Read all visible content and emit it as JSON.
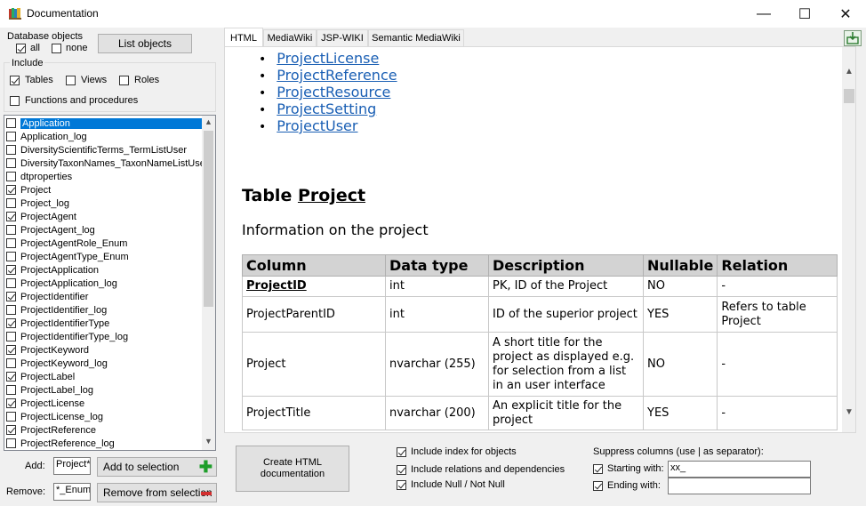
{
  "window": {
    "title": "Documentation",
    "minimize": "—",
    "maximize": "☐",
    "close": "✕"
  },
  "left": {
    "db_objects_label": "Database objects",
    "all_label": "all",
    "none_label": "none",
    "list_objects_button": "List objects",
    "include_label": "Include",
    "tables_label": "Tables",
    "views_label": "Views",
    "roles_label": "Roles",
    "functions_label": "Functions and procedures",
    "objects": [
      {
        "name": "Application",
        "checked": false,
        "selected": true
      },
      {
        "name": "Application_log",
        "checked": false
      },
      {
        "name": "DiversityScientificTerms_TermListUser",
        "checked": false
      },
      {
        "name": "DiversityTaxonNames_TaxonNameListUser",
        "checked": false
      },
      {
        "name": "dtproperties",
        "checked": false
      },
      {
        "name": "Project",
        "checked": true
      },
      {
        "name": "Project_log",
        "checked": false
      },
      {
        "name": "ProjectAgent",
        "checked": true
      },
      {
        "name": "ProjectAgent_log",
        "checked": false
      },
      {
        "name": "ProjectAgentRole_Enum",
        "checked": false
      },
      {
        "name": "ProjectAgentType_Enum",
        "checked": false
      },
      {
        "name": "ProjectApplication",
        "checked": true
      },
      {
        "name": "ProjectApplication_log",
        "checked": false
      },
      {
        "name": "ProjectIdentifier",
        "checked": true
      },
      {
        "name": "ProjectIdentifier_log",
        "checked": false
      },
      {
        "name": "ProjectIdentifierType",
        "checked": true
      },
      {
        "name": "ProjectIdentifierType_log",
        "checked": false
      },
      {
        "name": "ProjectKeyword",
        "checked": true
      },
      {
        "name": "ProjectKeyword_log",
        "checked": false
      },
      {
        "name": "ProjectLabel",
        "checked": true
      },
      {
        "name": "ProjectLabel_log",
        "checked": false
      },
      {
        "name": "ProjectLicense",
        "checked": true
      },
      {
        "name": "ProjectLicense_log",
        "checked": false
      },
      {
        "name": "ProjectReference",
        "checked": true
      },
      {
        "name": "ProjectReference_log",
        "checked": false
      }
    ],
    "add_label": "Add:",
    "add_value": "Project*",
    "add_button": "Add to selection",
    "remove_label": "Remove:",
    "remove_value": "*_Enum",
    "remove_button": "Remove from selection"
  },
  "tabs": [
    "HTML",
    "MediaWiki",
    "JSP-WIKI",
    "Semantic MediaWiki"
  ],
  "doc": {
    "links": [
      "ProjectLicense",
      "ProjectReference",
      "ProjectResource",
      "ProjectSetting",
      "ProjectUser"
    ],
    "table_heading_prefix": "Table ",
    "table_heading_name": "Project",
    "table_description": "Information on the project",
    "columns": [
      "Column",
      "Data type",
      "Description",
      "Nullable",
      "Relation"
    ],
    "rows": [
      {
        "column": "ProjectID",
        "pk": true,
        "type": "int",
        "description": "PK, ID of the Project",
        "nullable": "NO",
        "relation": "-"
      },
      {
        "column": "ProjectParentID",
        "type": "int",
        "description": "ID of the superior project",
        "nullable": "YES",
        "relation": "Refers to table Project"
      },
      {
        "column": "Project",
        "type": "nvarchar (255)",
        "description": "A short title for the project as displayed e.g. for selection from a list in an user interface",
        "nullable": "NO",
        "relation": "-"
      },
      {
        "column": "ProjectTitle",
        "type": "nvarchar (200)",
        "description": "An explicit title for the project",
        "nullable": "YES",
        "relation": "-"
      }
    ]
  },
  "bottom": {
    "create_button": "Create HTML documentation",
    "include_index": "Include index for objects",
    "include_relations": "Include relations and dependencies",
    "include_null": "Include Null / Not Null",
    "suppress_label": "Suppress columns (use | as separator):",
    "starting_label": "Starting with:",
    "starting_value": "xx_",
    "ending_label": "Ending with:",
    "ending_value": ""
  },
  "colors": {
    "accent": "#0078d7",
    "link": "#1a5fb4",
    "add_icon": "#1e9e2a",
    "remove_icon": "#d32f2f"
  }
}
